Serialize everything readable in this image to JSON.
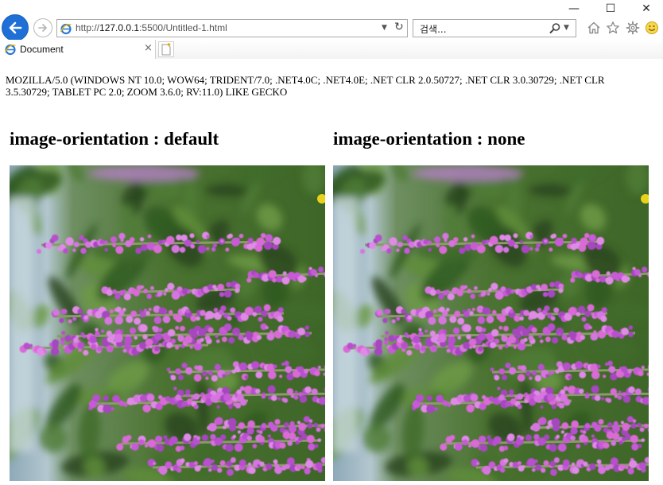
{
  "window": {
    "minimize_glyph": "—",
    "maximize_glyph": "☐",
    "close_glyph": "✕"
  },
  "toolbar": {
    "address_prefix": "http://",
    "address_host": "127.0.0.1",
    "address_rest": ":5500/Untitled-1.html",
    "dropdown_glyph": "▼",
    "refresh_glyph": "↻",
    "search_placeholder": "검색...",
    "search_dropdown_glyph": "▼"
  },
  "tabs": [
    {
      "title": "Document",
      "close_glyph": "×"
    }
  ],
  "page": {
    "user_agent": "MOZILLA/5.0 (WINDOWS NT 10.0; WOW64; TRIDENT/7.0; .NET4.0C; .NET4.0E; .NET CLR 2.0.50727; .NET CLR 3.0.30729; .NET CLR 3.5.30729; TABLET PC 2.0; ZOOM 3.6.0; RV:11.0) LIKE GECKO",
    "sections": [
      {
        "heading": "image-orientation : default"
      },
      {
        "heading": "image-orientation : none"
      }
    ]
  },
  "icons": {
    "back": "back-arrow-icon",
    "forward": "forward-arrow-icon",
    "site": "ie-page-icon",
    "search": "search-icon",
    "home": "home-icon",
    "favorites": "star-icon",
    "tools": "gear-icon",
    "feedback": "smiley-icon",
    "new_tab": "new-tab-icon"
  },
  "colors": {
    "back_button": "#1e6fd6",
    "flower_purple": "#c85ad8",
    "foliage_green": "#3f6b2c"
  }
}
